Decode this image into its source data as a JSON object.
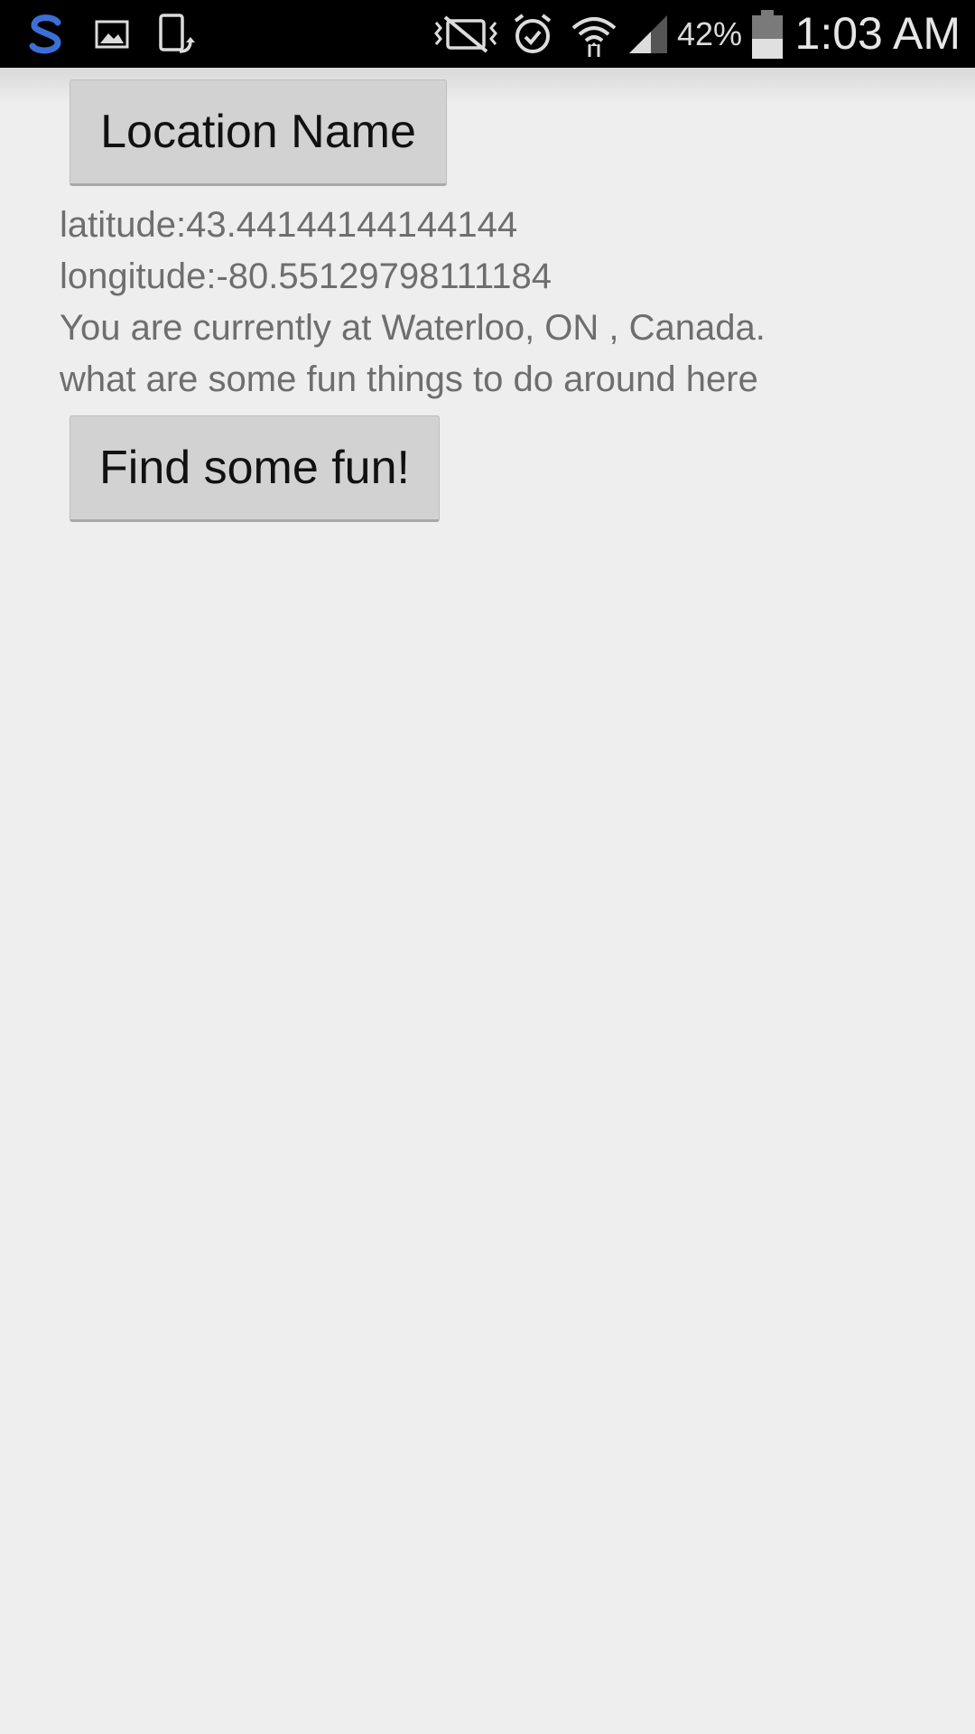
{
  "status_bar": {
    "icons": [
      "s-app-icon",
      "gallery-icon",
      "screen-rotate-icon",
      "vibrate-mute-icon",
      "alarm-icon",
      "wifi-icon",
      "signal-icon",
      "battery-icon"
    ],
    "battery_percent": "42%",
    "time": "1:03 AM",
    "accent_color": "#3b6fd6"
  },
  "main": {
    "location_button_label": "Location Name",
    "latitude_text": "latitude:43.441441441441​44",
    "longitude_text": "longitude:-80.55129798111184",
    "location_sentence": "You are currently at Waterloo, ON , Canada.",
    "question_text": "what are some fun things to do around here",
    "fun_button_label": "Find some fun!"
  }
}
